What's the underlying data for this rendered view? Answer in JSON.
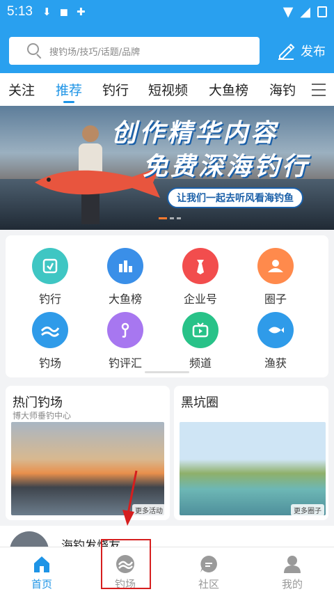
{
  "status_bar": {
    "time": "5:13"
  },
  "search": {
    "placeholder": "搜钓场/技巧/话题/品牌"
  },
  "header": {
    "publish_label": "发布"
  },
  "tabs": [
    {
      "label": "关注"
    },
    {
      "label": "推荐",
      "active": true
    },
    {
      "label": "钓行"
    },
    {
      "label": "短视频"
    },
    {
      "label": "大鱼榜"
    },
    {
      "label": "海钓"
    }
  ],
  "banner": {
    "line1": "创作精华内容",
    "line2": "免费深海钓行",
    "tagline": "让我们一起去听风看海钓鱼"
  },
  "grid": [
    {
      "label": "钓行",
      "color": "#3fc6c3",
      "icon": "fishing-trip-icon"
    },
    {
      "label": "大鱼榜",
      "color": "#3a8fe8",
      "icon": "big-fish-ranking-icon"
    },
    {
      "label": "企业号",
      "color": "#f24d4d",
      "icon": "enterprise-icon"
    },
    {
      "label": "圈子",
      "color": "#ff8a4c",
      "icon": "circle-icon"
    },
    {
      "label": "钓场",
      "color": "#2f9be9",
      "icon": "fishing-spot-icon"
    },
    {
      "label": "钓评汇",
      "color": "#a777f0",
      "icon": "review-icon"
    },
    {
      "label": "频道",
      "color": "#28c288",
      "icon": "channel-icon"
    },
    {
      "label": "渔获",
      "color": "#2f9be9",
      "icon": "catch-icon"
    }
  ],
  "cards": {
    "hot": {
      "title": "热门钓场",
      "subtitle": "博大师垂钓中心",
      "more": "更多活动"
    },
    "pit": {
      "title": "黑坑圈",
      "more": "更多圈子"
    }
  },
  "feed": {
    "title": "海钓发烧友"
  },
  "bottom_nav": [
    {
      "label": "首页",
      "active": true,
      "icon": "home-icon"
    },
    {
      "label": "钓场",
      "icon": "fishing-spot-icon"
    },
    {
      "label": "社区",
      "icon": "community-icon"
    },
    {
      "label": "我的",
      "icon": "profile-icon"
    }
  ],
  "colors": {
    "brand": "#29a0ef",
    "active": "#1e94e6",
    "annotation": "#d61e1e"
  }
}
